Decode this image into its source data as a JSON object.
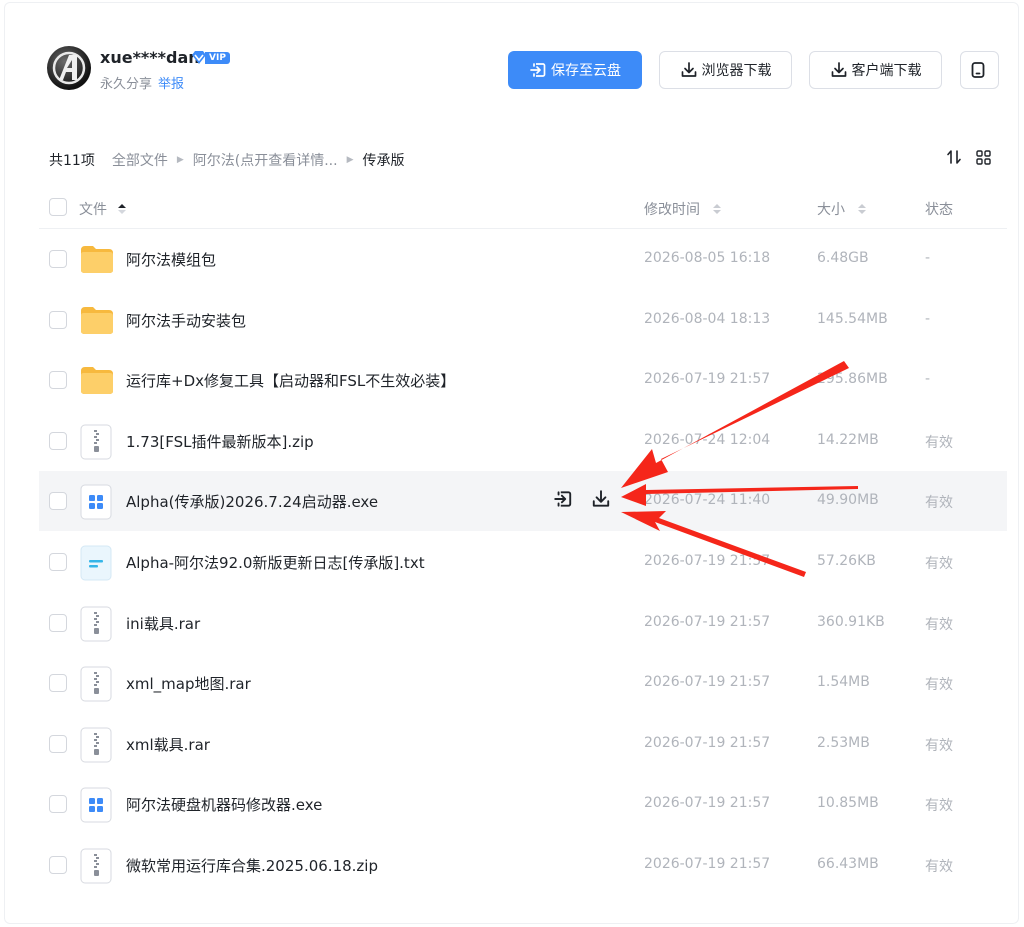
{
  "user": {
    "name": "xue****dan",
    "vip_label": "VIP",
    "share_type": "永久分享",
    "report_label": "举报"
  },
  "toolbar": {
    "save_label": "保存至云盘",
    "browser_download_label": "浏览器下载",
    "client_download_label": "客户端下载"
  },
  "breadcrumb": {
    "count": "共11项",
    "items": [
      "全部文件",
      "阿尔法(点开查看详情...",
      "传承版"
    ]
  },
  "columns": {
    "file": "文件",
    "mtime": "修改时间",
    "size": "大小",
    "status": "状态"
  },
  "files": [
    {
      "name": "阿尔法模组包",
      "type": "folder",
      "mtime": "2026-08-05 16:18",
      "size": "6.48GB",
      "status": "-"
    },
    {
      "name": "阿尔法手动安装包",
      "type": "folder",
      "mtime": "2026-08-04 18:13",
      "size": "145.54MB",
      "status": "-"
    },
    {
      "name": "运行库+Dx修复工具【启动器和FSL不生效必装】",
      "type": "folder",
      "mtime": "2026-07-19 21:57",
      "size": "295.86MB",
      "status": "-"
    },
    {
      "name": "1.73[FSL插件最新版本].zip",
      "type": "zip",
      "mtime": "2026-07-24 12:04",
      "size": "14.22MB",
      "status": "有效"
    },
    {
      "name": "Alpha(传承版)2026.7.24启动器.exe",
      "type": "exe",
      "mtime": "2026-07-24 11:40",
      "size": "49.90MB",
      "status": "有效"
    },
    {
      "name": "Alpha-阿尔法92.0新版更新日志[传承版].txt",
      "type": "txt",
      "mtime": "2026-07-19 21:57",
      "size": "57.26KB",
      "status": "有效"
    },
    {
      "name": "ini载具.rar",
      "type": "zip",
      "mtime": "2026-07-19 21:57",
      "size": "360.91KB",
      "status": "有效"
    },
    {
      "name": "xml_map地图.rar",
      "type": "zip",
      "mtime": "2026-07-19 21:57",
      "size": "1.54MB",
      "status": "有效"
    },
    {
      "name": "xml载具.rar",
      "type": "zip",
      "mtime": "2026-07-19 21:57",
      "size": "2.53MB",
      "status": "有效"
    },
    {
      "name": "阿尔法硬盘机器码修改器.exe",
      "type": "exe",
      "mtime": "2026-07-19 21:57",
      "size": "10.85MB",
      "status": "有效"
    },
    {
      "name": "微软常用运行库合集.2025.06.18.zip",
      "type": "zip",
      "mtime": "2026-07-19 21:57",
      "size": "66.43MB",
      "status": "有效"
    }
  ],
  "hovered_row_index": 4,
  "colors": {
    "accent": "#3d8bf8",
    "folder": "#fdc85c",
    "annotation_arrow": "#f5261a"
  }
}
